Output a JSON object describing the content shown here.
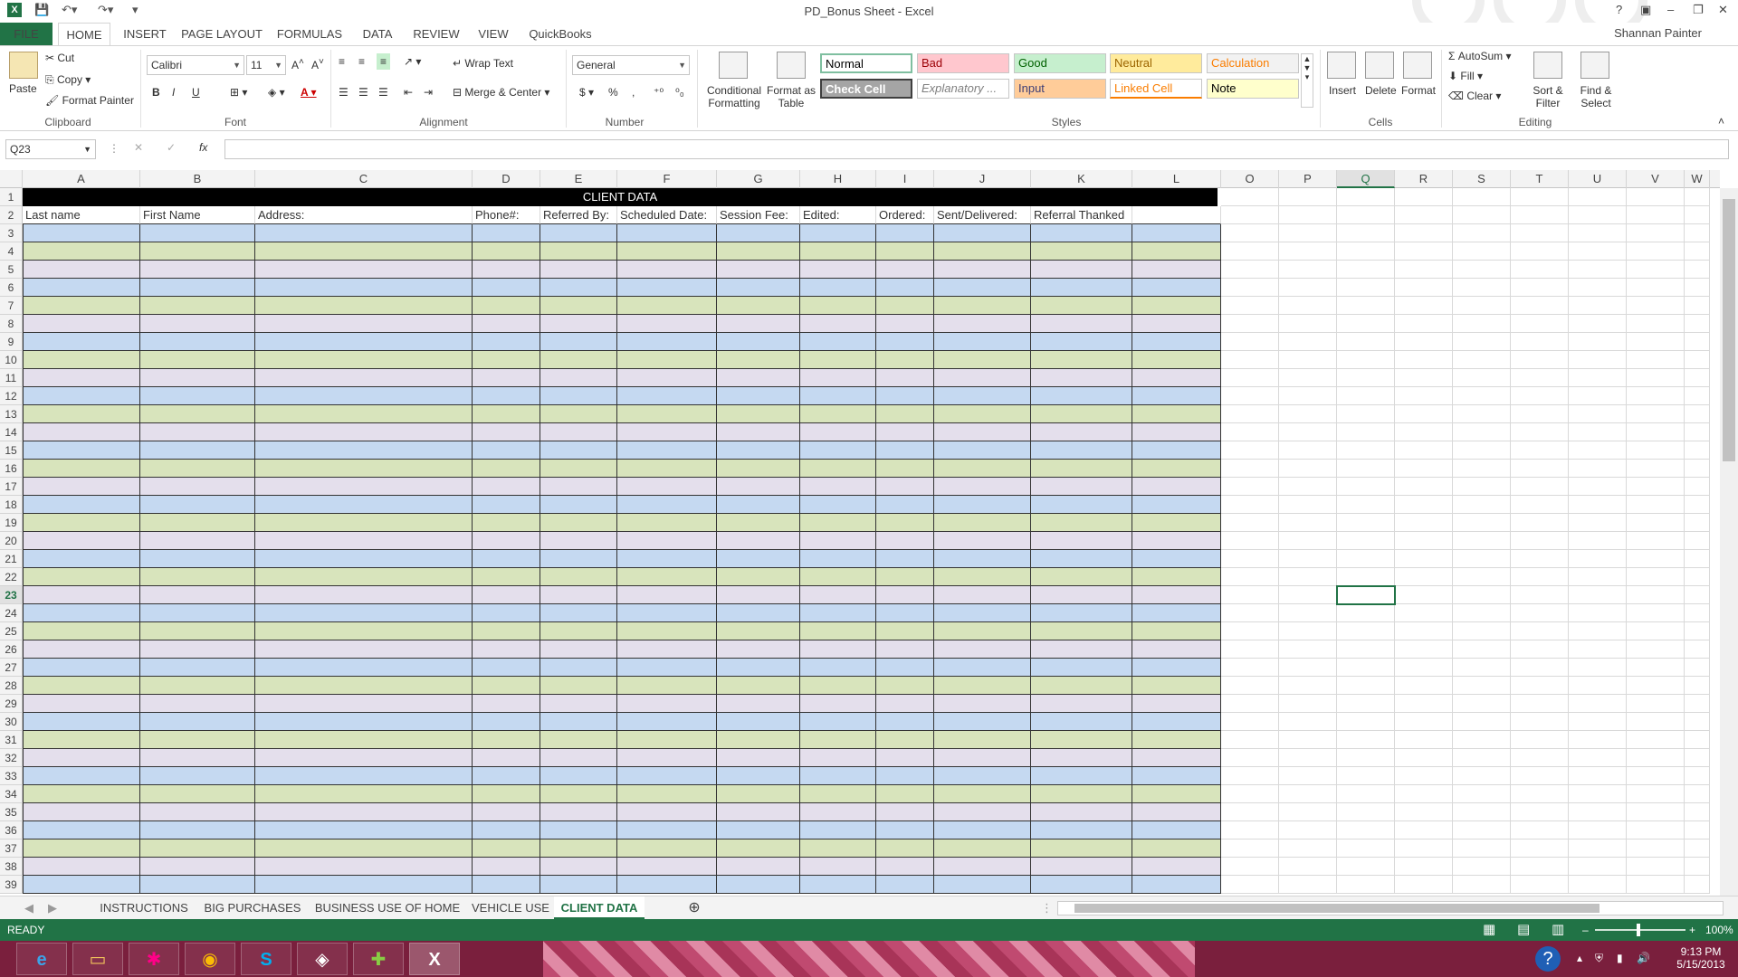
{
  "window": {
    "title": "PD_Bonus Sheet - Excel",
    "user": "Shannan Painter"
  },
  "ribbon_tabs": [
    "FILE",
    "HOME",
    "INSERT",
    "PAGE LAYOUT",
    "FORMULAS",
    "DATA",
    "REVIEW",
    "VIEW",
    "QuickBooks"
  ],
  "clipboard": {
    "paste": "Paste",
    "cut": "Cut",
    "copy": "Copy",
    "format_painter": "Format Painter",
    "group": "Clipboard"
  },
  "font": {
    "name": "Calibri",
    "size": "11",
    "bold": "B",
    "italic": "I",
    "underline": "U",
    "group": "Font"
  },
  "alignment": {
    "wrap": "Wrap Text",
    "merge": "Merge & Center",
    "group": "Alignment"
  },
  "number": {
    "format": "General",
    "currency": "$",
    "percent": "%",
    "comma": ",",
    "group": "Number"
  },
  "styles": {
    "conditional": "Conditional Formatting",
    "format_table": "Format as Table",
    "group": "Styles",
    "items": [
      {
        "label": "Normal",
        "bg": "#ffffff",
        "fg": "#000000"
      },
      {
        "label": "Bad",
        "bg": "#ffc7ce",
        "fg": "#9c0006"
      },
      {
        "label": "Good",
        "bg": "#c6efce",
        "fg": "#006100"
      },
      {
        "label": "Neutral",
        "bg": "#ffeb9c",
        "fg": "#9c6500"
      },
      {
        "label": "Calculation",
        "bg": "#f2f2f2",
        "fg": "#fa7d00"
      },
      {
        "label": "Check Cell",
        "bg": "#a5a5a5",
        "fg": "#ffffff"
      },
      {
        "label": "Explanatory ...",
        "bg": "#ffffff",
        "fg": "#7f7f7f"
      },
      {
        "label": "Input",
        "bg": "#ffcc99",
        "fg": "#3f3f76"
      },
      {
        "label": "Linked Cell",
        "bg": "#ffffff",
        "fg": "#fa7d00"
      },
      {
        "label": "Note",
        "bg": "#ffffcc",
        "fg": "#000000"
      }
    ]
  },
  "cells_group": {
    "insert": "Insert",
    "delete": "Delete",
    "format": "Format",
    "group": "Cells"
  },
  "editing": {
    "autosum": "AutoSum",
    "fill": "Fill",
    "clear": "Clear",
    "sort": "Sort & Filter",
    "find": "Find & Select",
    "group": "Editing"
  },
  "formula_bar": {
    "name_box": "Q23",
    "fx": "fx",
    "value": ""
  },
  "columns": [
    "A",
    "B",
    "C",
    "D",
    "E",
    "F",
    "G",
    "H",
    "I",
    "J",
    "K",
    "L",
    "O",
    "P",
    "Q",
    "R",
    "S",
    "T",
    "U",
    "V",
    "W"
  ],
  "sheet": {
    "banner": "CLIENT DATA",
    "headers": [
      "Last name",
      "First Name",
      "Address:",
      "Phone#:",
      "Referred By:",
      "Scheduled Date:",
      "Session Fee:",
      "Edited:",
      "Ordered:",
      "Sent/Delivered:",
      "Referral Thanked",
      ""
    ],
    "band_colors": [
      "#c5d9f1",
      "#d8e4bc",
      "#e4dfec"
    ],
    "first_row": 1,
    "last_row": 39,
    "selected_row": 23,
    "selected_col": "Q"
  },
  "sheet_tabs": [
    "INSTRUCTIONS",
    "BIG PURCHASES",
    "BUSINESS USE OF HOME",
    "VEHICLE USE",
    "CLIENT DATA"
  ],
  "active_sheet": "CLIENT DATA",
  "status": {
    "mode": "READY",
    "zoom": "100%"
  },
  "taskbar": {
    "time": "9:13 PM",
    "date": "5/15/2013"
  }
}
